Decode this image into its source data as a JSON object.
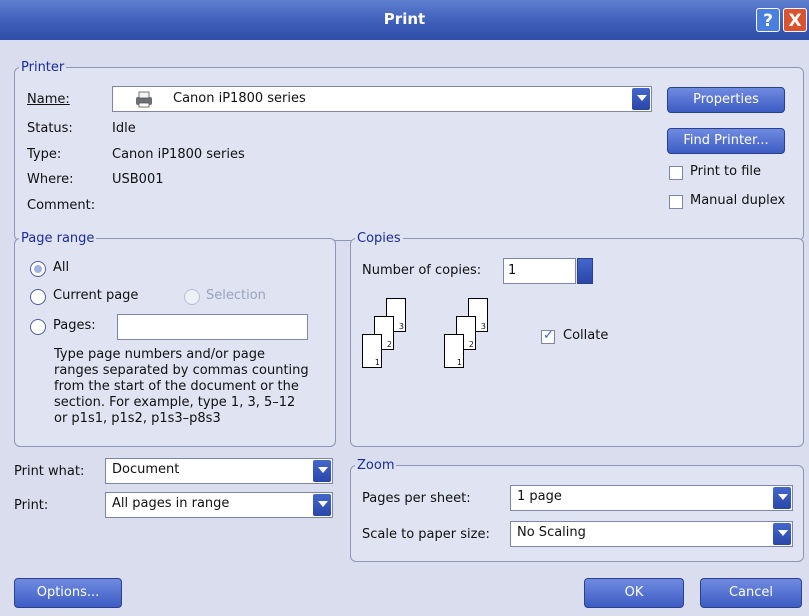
{
  "window": {
    "title": "Print",
    "help_label": "?",
    "close_label": "X"
  },
  "printer": {
    "legend": "Printer",
    "name_label": "Name:",
    "name_value": "Canon iP1800 series",
    "status_label": "Status:",
    "status_value": "Idle",
    "type_label": "Type:",
    "type_value": "Canon iP1800 series",
    "where_label": "Where:",
    "where_value": "USB001",
    "comment_label": "Comment:",
    "properties_label": "Properties",
    "find_printer_label": "Find Printer...",
    "print_to_file_label": "Print to file",
    "manual_duplex_label": "Manual duplex"
  },
  "page_range": {
    "legend": "Page range",
    "all_label": "All",
    "current_page_label": "Current page",
    "selection_label": "Selection",
    "pages_label": "Pages:",
    "pages_value": "",
    "help_lines": [
      "Type page numbers and/or page",
      "ranges separated by commas counting",
      "from the start of the document or the",
      "section. For example, type 1, 3, 5–12",
      "or p1s1, p1s2, p1s3–p8s3"
    ]
  },
  "copies": {
    "legend": "Copies",
    "number_label": "Number of copies:",
    "number_value": "1",
    "collate_label": "Collate",
    "page_numbers": [
      "1",
      "2",
      "3"
    ]
  },
  "print_what": {
    "label": "Print what:",
    "value": "Document"
  },
  "print": {
    "label": "Print:",
    "value": "All pages in range"
  },
  "zoom": {
    "legend": "Zoom",
    "pages_per_sheet_label": "Pages per sheet:",
    "pages_per_sheet_value": "1 page",
    "scale_label": "Scale to paper size:",
    "scale_value": "No Scaling"
  },
  "buttons": {
    "options_label": "Options...",
    "ok_label": "OK",
    "cancel_label": "Cancel"
  },
  "state": {
    "all_selected": true,
    "collate_checked": true,
    "print_to_file_checked": false,
    "manual_duplex_checked": false
  }
}
